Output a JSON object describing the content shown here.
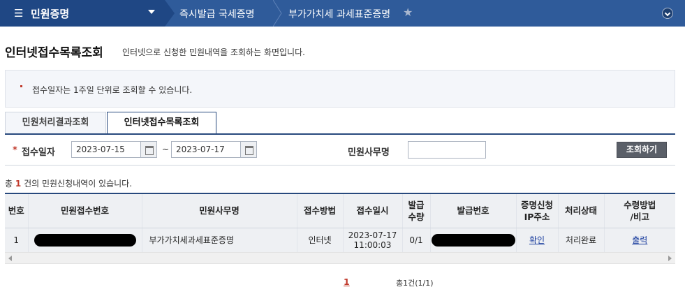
{
  "nav": {
    "menu_title": "민원증명",
    "breadcrumb_1": "즉시발급 국세증명",
    "breadcrumb_2": "부가가치세 과세표준증명",
    "menu_icon": "hamburger-icon",
    "star_icon": "star-icon",
    "expand_icon": "chevron-down-circle-icon"
  },
  "header": {
    "title": "인터넷접수목록조회",
    "description": "인터넷으로 신청한 민원내역을 조회하는 화면입니다."
  },
  "notice": {
    "text": "접수일자는 1주일 단위로 조회할 수 있습니다."
  },
  "tabs": [
    {
      "label": "민원처리결과조회",
      "active": false
    },
    {
      "label": "인터넷접수목록조회",
      "active": true
    }
  ],
  "search": {
    "date_label": "접수일자",
    "required_mark": "*",
    "date_from": "2023-07-15",
    "date_separator": "~",
    "date_to": "2023-07-17",
    "office_label": "민원사무명",
    "office_value": "",
    "submit_label": "조회하기"
  },
  "result_count": {
    "prefix": "총",
    "count": "1",
    "suffix": "건의 민원신청내역이 있습니다."
  },
  "table": {
    "headers": {
      "no": "번호",
      "receipt_no": "민원접수번호",
      "office": "민원사무명",
      "method": "접수방법",
      "date": "접수일시",
      "qty_1": "발급",
      "qty_2": "수량",
      "issue_no": "발급번호",
      "ip_1": "증명신청",
      "ip_2": "IP주소",
      "status": "처리상태",
      "recv_1": "수령방법",
      "recv_2": "/비고"
    },
    "rows": [
      {
        "no": "1",
        "office": "부가가치세과세표준증명",
        "method": "인터넷",
        "date_1": "2023-07-17",
        "date_2": "11:00:03",
        "qty": "0/1",
        "ip_link": "확인",
        "status": "처리완료",
        "recv_link": "출력"
      }
    ]
  },
  "pagination": {
    "current": "1",
    "summary": "총1건(1/1)"
  },
  "colors": {
    "nav_bg": "#2f5b9a",
    "nav_dark": "#1f4784",
    "accent_line": "#27497d",
    "count_red": "#c0392b",
    "button_gray": "#5a5f68"
  }
}
